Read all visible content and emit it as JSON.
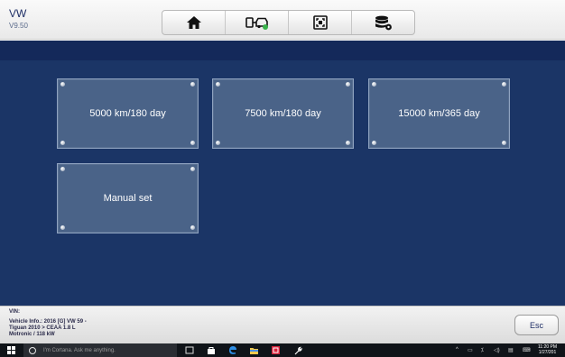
{
  "header": {
    "title": "VW",
    "version": "V9.50",
    "toolbar": [
      {
        "icon": "home-icon"
      },
      {
        "icon": "vehicle-connect-icon"
      },
      {
        "icon": "screenshot-icon"
      },
      {
        "icon": "data-settings-icon"
      }
    ]
  },
  "tiles": [
    {
      "label": "5000 km/180 day"
    },
    {
      "label": "7500 km/180 day"
    },
    {
      "label": "15000 km/365 day"
    },
    {
      "label": "Manual set"
    }
  ],
  "vehicle": {
    "vin_label": "VIN:",
    "info_line1": "Vehicle Info.: 2016 [G] VW 59 -",
    "info_line2": "Tiguan 2010 > CEAA 1.8 L",
    "info_line3": "Motronic / 118 kW"
  },
  "esc_label": "Esc",
  "taskbar": {
    "search_placeholder": "I'm Cortana. Ask me anything.",
    "time": "11:20 PM",
    "date": "1/27/201"
  }
}
